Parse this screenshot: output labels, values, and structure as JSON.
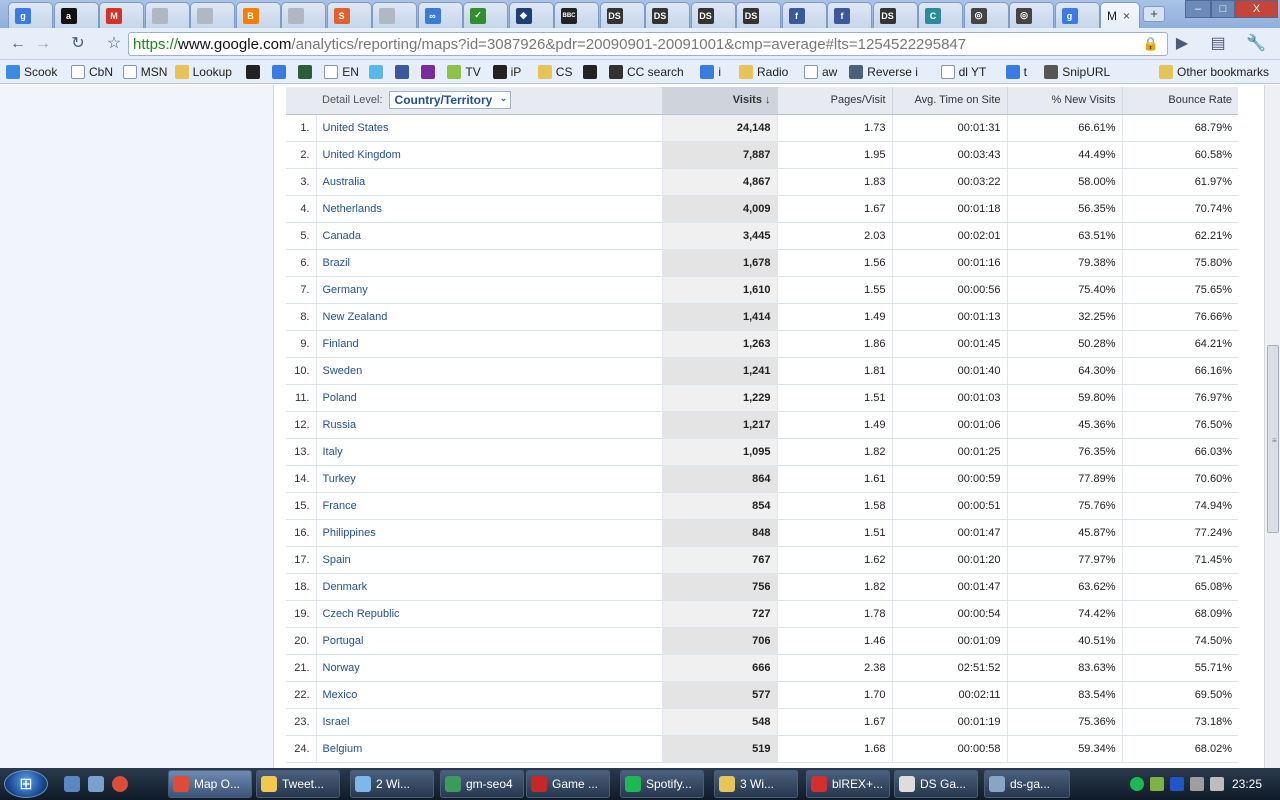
{
  "browser": {
    "tabs": [
      {
        "icon": "google-icon",
        "color": "#3b7ae0",
        "glyph": "g"
      },
      {
        "icon": "amazon-icon",
        "color": "#111111",
        "glyph": "a"
      },
      {
        "icon": "gmail-icon",
        "color": "#d93025",
        "glyph": "M"
      },
      {
        "icon": "page-icon",
        "color": "#b0b8c4",
        "glyph": ""
      },
      {
        "icon": "page-icon",
        "color": "#b0b8c4",
        "glyph": ""
      },
      {
        "icon": "blogger-icon",
        "color": "#f57d00",
        "glyph": "B"
      },
      {
        "icon": "page-icon",
        "color": "#b0b8c4",
        "glyph": ""
      },
      {
        "icon": "slideshare-icon",
        "color": "#e0612e",
        "glyph": "S"
      },
      {
        "icon": "page-icon",
        "color": "#b0b8c4",
        "glyph": ""
      },
      {
        "icon": "link-icon",
        "color": "#3a7bd5",
        "glyph": "∞"
      },
      {
        "icon": "check-icon",
        "color": "#2f8f2f",
        "glyph": "✓"
      },
      {
        "icon": "shield-icon",
        "color": "#1d3f72",
        "glyph": "◆"
      },
      {
        "icon": "bbc-icon",
        "color": "#222222",
        "glyph": "BBC"
      },
      {
        "icon": "ds-icon",
        "color": "#333333",
        "glyph": "DS"
      },
      {
        "icon": "ds-icon",
        "color": "#333333",
        "glyph": "DS"
      },
      {
        "icon": "ds-icon",
        "color": "#333333",
        "glyph": "DS"
      },
      {
        "icon": "ds-icon",
        "color": "#333333",
        "glyph": "DS"
      },
      {
        "icon": "facebook-icon",
        "color": "#3b5998",
        "glyph": "f"
      },
      {
        "icon": "facebook-icon",
        "color": "#3b5998",
        "glyph": "f"
      },
      {
        "icon": "ds-icon",
        "color": "#333333",
        "glyph": "DS"
      },
      {
        "icon": "compass-icon",
        "color": "#2c8a9a",
        "glyph": "C"
      },
      {
        "icon": "target-icon",
        "color": "#444444",
        "glyph": "◎"
      },
      {
        "icon": "target-icon",
        "color": "#444444",
        "glyph": "◎"
      },
      {
        "icon": "google-icon",
        "color": "#3b7ae0",
        "glyph": "g"
      }
    ],
    "active_tab": {
      "title": "M",
      "close": "×"
    },
    "new_tab": "+",
    "window_controls": {
      "minimize": "–",
      "maximize": "□",
      "close": "X"
    },
    "url": {
      "scheme": "https://",
      "host": "www.google.com",
      "path": "/analytics/reporting/maps?id=3087926&pdr=20090901-20091001&cmp=average#lts=1254522295847"
    },
    "bookmarks": [
      {
        "label": "Scook",
        "icon": "drop-icon",
        "color": "#3a8be0"
      },
      {
        "label": "CbN",
        "icon": "page-icon",
        "color": "#ffffff"
      },
      {
        "label": "MSN",
        "icon": "page-icon",
        "color": "#ffffff"
      },
      {
        "label": "Lookup",
        "icon": "folder-icon",
        "color": "#e7c45a"
      },
      {
        "label": "",
        "icon": "bbc-icon",
        "color": "#222222"
      },
      {
        "label": "",
        "icon": "google-icon",
        "color": "#3b7ae0"
      },
      {
        "label": "",
        "icon": "flag-icon",
        "color": "#2b5f3a"
      },
      {
        "label": "EN",
        "icon": "page-icon",
        "color": "#ffffff"
      },
      {
        "label": "",
        "icon": "twitter-icon",
        "color": "#5cb8e8"
      },
      {
        "label": "",
        "icon": "facebook-icon",
        "color": "#3b5998"
      },
      {
        "label": "",
        "icon": "square-icon",
        "color": "#7a2a9a"
      },
      {
        "label": "TV",
        "icon": "circle-icon",
        "color": "#8bc34a"
      },
      {
        "label": "iP",
        "icon": "bbc-icon",
        "color": "#222222"
      },
      {
        "label": "CS",
        "icon": "folder-icon",
        "color": "#e7c45a"
      },
      {
        "label": "",
        "icon": "tf-icon",
        "color": "#222222"
      },
      {
        "label": "CC search",
        "icon": "cc-icon",
        "color": "#333333"
      },
      {
        "label": "i",
        "icon": "google-icon",
        "color": "#3b7ae0"
      },
      {
        "label": "Radio",
        "icon": "folder-icon",
        "color": "#e7c45a"
      },
      {
        "label": "aw",
        "icon": "page-icon",
        "color": "#ffffff"
      },
      {
        "label": "Reverse i",
        "icon": "image-icon",
        "color": "#4b5f7a"
      },
      {
        "label": "dl YT",
        "icon": "page-icon",
        "color": "#ffffff"
      },
      {
        "label": "t",
        "icon": "google-icon",
        "color": "#3b7ae0"
      },
      {
        "label": "SnipURL",
        "icon": "scissors-icon",
        "color": "#555555"
      }
    ],
    "other_bookmarks": "Other bookmarks"
  },
  "report": {
    "detail_label": "Detail Level:",
    "detail_value": "Country/Territory",
    "columns": {
      "visits": "Visits",
      "pages_per_visit": "Pages/Visit",
      "avg_time": "Avg. Time on Site",
      "new_visits": "% New Visits",
      "bounce_rate": "Bounce Rate"
    },
    "rows": [
      {
        "idx": "1.",
        "name": "United States",
        "visits": "24,148",
        "ppv": "1.73",
        "time": "00:01:31",
        "nv": "66.61%",
        "br": "68.79%"
      },
      {
        "idx": "2.",
        "name": "United Kingdom",
        "visits": "7,887",
        "ppv": "1.95",
        "time": "00:03:43",
        "nv": "44.49%",
        "br": "60.58%"
      },
      {
        "idx": "3.",
        "name": "Australia",
        "visits": "4,867",
        "ppv": "1.83",
        "time": "00:03:22",
        "nv": "58.00%",
        "br": "61.97%"
      },
      {
        "idx": "4.",
        "name": "Netherlands",
        "visits": "4,009",
        "ppv": "1.67",
        "time": "00:01:18",
        "nv": "56.35%",
        "br": "70.74%"
      },
      {
        "idx": "5.",
        "name": "Canada",
        "visits": "3,445",
        "ppv": "2.03",
        "time": "00:02:01",
        "nv": "63.51%",
        "br": "62.21%"
      },
      {
        "idx": "6.",
        "name": "Brazil",
        "visits": "1,678",
        "ppv": "1.56",
        "time": "00:01:16",
        "nv": "79.38%",
        "br": "75.80%"
      },
      {
        "idx": "7.",
        "name": "Germany",
        "visits": "1,610",
        "ppv": "1.55",
        "time": "00:00:56",
        "nv": "75.40%",
        "br": "75.65%"
      },
      {
        "idx": "8.",
        "name": "New Zealand",
        "visits": "1,414",
        "ppv": "1.49",
        "time": "00:01:13",
        "nv": "32.25%",
        "br": "76.66%"
      },
      {
        "idx": "9.",
        "name": "Finland",
        "visits": "1,263",
        "ppv": "1.86",
        "time": "00:01:45",
        "nv": "50.28%",
        "br": "64.21%"
      },
      {
        "idx": "10.",
        "name": "Sweden",
        "visits": "1,241",
        "ppv": "1.81",
        "time": "00:01:40",
        "nv": "64.30%",
        "br": "66.16%"
      },
      {
        "idx": "11.",
        "name": "Poland",
        "visits": "1,229",
        "ppv": "1.51",
        "time": "00:01:03",
        "nv": "59.80%",
        "br": "76.97%"
      },
      {
        "idx": "12.",
        "name": "Russia",
        "visits": "1,217",
        "ppv": "1.49",
        "time": "00:01:06",
        "nv": "45.36%",
        "br": "76.50%"
      },
      {
        "idx": "13.",
        "name": "Italy",
        "visits": "1,095",
        "ppv": "1.82",
        "time": "00:01:25",
        "nv": "76.35%",
        "br": "66.03%"
      },
      {
        "idx": "14.",
        "name": "Turkey",
        "visits": "864",
        "ppv": "1.61",
        "time": "00:00:59",
        "nv": "77.89%",
        "br": "70.60%"
      },
      {
        "idx": "15.",
        "name": "France",
        "visits": "854",
        "ppv": "1.58",
        "time": "00:00:51",
        "nv": "75.76%",
        "br": "74.94%"
      },
      {
        "idx": "16.",
        "name": "Philippines",
        "visits": "848",
        "ppv": "1.51",
        "time": "00:01:47",
        "nv": "45.87%",
        "br": "77.24%"
      },
      {
        "idx": "17.",
        "name": "Spain",
        "visits": "767",
        "ppv": "1.62",
        "time": "00:01:20",
        "nv": "77.97%",
        "br": "71.45%"
      },
      {
        "idx": "18.",
        "name": "Denmark",
        "visits": "756",
        "ppv": "1.82",
        "time": "00:01:47",
        "nv": "63.62%",
        "br": "65.08%"
      },
      {
        "idx": "19.",
        "name": "Czech Republic",
        "visits": "727",
        "ppv": "1.78",
        "time": "00:00:54",
        "nv": "74.42%",
        "br": "68.09%"
      },
      {
        "idx": "20.",
        "name": "Portugal",
        "visits": "706",
        "ppv": "1.46",
        "time": "00:01:09",
        "nv": "40.51%",
        "br": "74.50%"
      },
      {
        "idx": "21.",
        "name": "Norway",
        "visits": "666",
        "ppv": "2.38",
        "time": "02:51:52",
        "nv": "83.63%",
        "br": "55.71%"
      },
      {
        "idx": "22.",
        "name": "Mexico",
        "visits": "577",
        "ppv": "1.70",
        "time": "00:02:11",
        "nv": "83.54%",
        "br": "69.50%"
      },
      {
        "idx": "23.",
        "name": "Israel",
        "visits": "548",
        "ppv": "1.67",
        "time": "00:01:19",
        "nv": "75.36%",
        "br": "73.18%"
      },
      {
        "idx": "24.",
        "name": "Belgium",
        "visits": "519",
        "ppv": "1.68",
        "time": "00:00:58",
        "nv": "59.34%",
        "br": "68.02%"
      }
    ]
  },
  "taskbar": {
    "tasks": [
      {
        "label": "Map O...",
        "icon": "chrome-icon",
        "color": "#dd4b39"
      },
      {
        "label": "Tweet...",
        "icon": "mail-icon",
        "color": "#f2c94c"
      },
      {
        "label": "2 Wi...",
        "icon": "windows-explorer-icon",
        "color": "#7cb8e8"
      },
      {
        "label": "gm-seo4",
        "icon": "spreadsheet-icon",
        "color": "#3c9a5f"
      },
      {
        "label": "Game ...",
        "icon": "game-icon",
        "color": "#c62828"
      },
      {
        "label": "Spotify...",
        "icon": "spotify-icon",
        "color": "#1db954"
      },
      {
        "label": "3 Wi...",
        "icon": "folder-icon",
        "color": "#e7c45a"
      },
      {
        "label": "blREX+...",
        "icon": "pdf-icon",
        "color": "#d32f2f"
      },
      {
        "label": "DS Ga...",
        "icon": "ds-icon",
        "color": "#dddddd"
      },
      {
        "label": "ds-ga...",
        "icon": "document-icon",
        "color": "#8aa4c8"
      }
    ],
    "clock": "23:25"
  }
}
